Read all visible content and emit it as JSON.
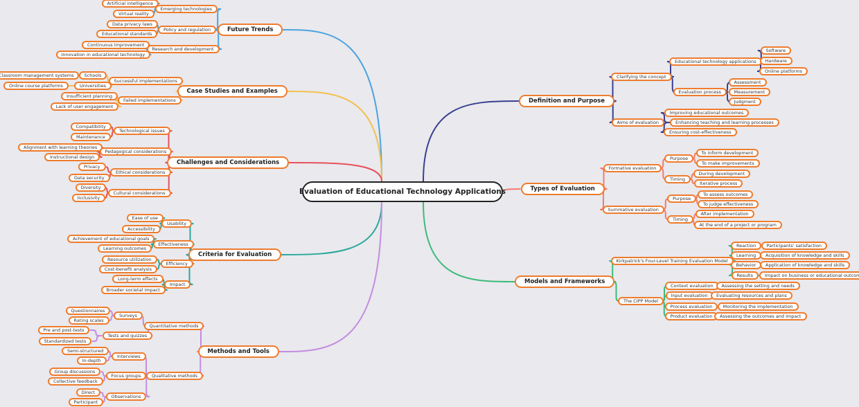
{
  "title": "Evaluation of Educational Technology Applications",
  "colors": {
    "background": "#e9e9ee",
    "node_border": "#ef7b2b",
    "root_border": "#222222"
  },
  "branches": [
    {
      "label": "Future Trends",
      "color": "#4aa3df",
      "side": "left",
      "children": [
        {
          "label": "Emerging technologies",
          "children": [
            {
              "label": "Artificial intelligence"
            },
            {
              "label": "Virtual reality"
            }
          ]
        },
        {
          "label": "Policy and regulation",
          "children": [
            {
              "label": "Data privacy laws"
            },
            {
              "label": "Educational standards"
            }
          ]
        },
        {
          "label": "Research and development",
          "children": [
            {
              "label": "Continuous improvement"
            },
            {
              "label": "Innovation in educational technology"
            }
          ]
        }
      ]
    },
    {
      "label": "Case Studies and Examples",
      "color": "#f2c14e",
      "side": "left",
      "children": [
        {
          "label": "Successful implementations",
          "children": [
            {
              "label": "Schools",
              "children": [
                {
                  "label": "Classroom management systems"
                }
              ]
            },
            {
              "label": "Universities",
              "children": [
                {
                  "label": "Online course platforms"
                }
              ]
            }
          ]
        },
        {
          "label": "Failed implementations",
          "children": [
            {
              "label": "Insufficient planning"
            },
            {
              "label": "Lack of user engagement"
            }
          ]
        }
      ]
    },
    {
      "label": "Challenges and Considerations",
      "color": "#e8505b",
      "side": "left",
      "children": [
        {
          "label": "Technological issues",
          "children": [
            {
              "label": "Compatibility"
            },
            {
              "label": "Maintenance"
            }
          ]
        },
        {
          "label": "Pedagogical considerations",
          "children": [
            {
              "label": "Alignment with learning theories"
            },
            {
              "label": "Instructional design"
            }
          ]
        },
        {
          "label": "Ethical considerations",
          "children": [
            {
              "label": "Privacy"
            },
            {
              "label": "Data security"
            }
          ]
        },
        {
          "label": "Cultural considerations",
          "children": [
            {
              "label": "Diversity"
            },
            {
              "label": "Inclusivity"
            }
          ]
        }
      ]
    },
    {
      "label": "Criteria for Evaluation",
      "color": "#2aa89a",
      "side": "left",
      "children": [
        {
          "label": "Usability",
          "children": [
            {
              "label": "Ease of use"
            },
            {
              "label": "Accessibility"
            }
          ]
        },
        {
          "label": "Effectiveness",
          "children": [
            {
              "label": "Achievement of educational goals"
            },
            {
              "label": "Learning outcomes"
            }
          ]
        },
        {
          "label": "Efficiency",
          "children": [
            {
              "label": "Resource utilization"
            },
            {
              "label": "Cost-benefit analysis"
            }
          ]
        },
        {
          "label": "Impact",
          "children": [
            {
              "label": "Long-term effects"
            },
            {
              "label": "Broader societal impact"
            }
          ]
        }
      ]
    },
    {
      "label": "Methods and Tools",
      "color": "#c58be0",
      "side": "left",
      "children": [
        {
          "label": "Quantitative methods",
          "children": [
            {
              "label": "Surveys",
              "children": [
                {
                  "label": "Questionnaires"
                },
                {
                  "label": "Rating scales"
                }
              ]
            },
            {
              "label": "Tests and quizzes",
              "children": [
                {
                  "label": "Pre and post-tests"
                },
                {
                  "label": "Standardized tests"
                }
              ]
            }
          ]
        },
        {
          "label": "Qualitative methods",
          "children": [
            {
              "label": "Interviews",
              "children": [
                {
                  "label": "Semi-structured"
                },
                {
                  "label": "In-depth"
                }
              ]
            },
            {
              "label": "Focus groups",
              "children": [
                {
                  "label": "Group discussions"
                },
                {
                  "label": "Collective feedback"
                }
              ]
            },
            {
              "label": "Observations",
              "children": [
                {
                  "label": "Direct"
                },
                {
                  "label": "Participant"
                }
              ]
            }
          ]
        }
      ]
    },
    {
      "label": "Definition and Purpose",
      "color": "#3a3f8f",
      "side": "right",
      "children": [
        {
          "label": "Clarifying the concept",
          "children": [
            {
              "label": "Educational technology applications",
              "children": [
                {
                  "label": "Software"
                },
                {
                  "label": "Hardware"
                },
                {
                  "label": "Online platforms"
                }
              ]
            },
            {
              "label": "Evaluation process",
              "children": [
                {
                  "label": "Assessment"
                },
                {
                  "label": "Measurement"
                },
                {
                  "label": "Judgment"
                }
              ]
            }
          ]
        },
        {
          "label": "Aims of evaluation",
          "children": [
            {
              "label": "Improving educational outcomes"
            },
            {
              "label": "Enhancing teaching and learning processes"
            },
            {
              "label": "Ensuring cost-effectiveness"
            }
          ]
        }
      ]
    },
    {
      "label": "Types of Evaluation",
      "color": "#f47a6e",
      "side": "right",
      "children": [
        {
          "label": "Formative evaluation",
          "children": [
            {
              "label": "Purpose",
              "children": [
                {
                  "label": "To inform development"
                },
                {
                  "label": "To make improvements"
                }
              ]
            },
            {
              "label": "Timing",
              "children": [
                {
                  "label": "During development"
                },
                {
                  "label": "Iterative process"
                }
              ]
            }
          ]
        },
        {
          "label": "Summative evaluation",
          "children": [
            {
              "label": "Purpose",
              "children": [
                {
                  "label": "To assess outcomes"
                },
                {
                  "label": "To judge effectiveness"
                }
              ]
            },
            {
              "label": "Timing",
              "children": [
                {
                  "label": "After implementation"
                },
                {
                  "label": "At the end of a project or program"
                }
              ]
            }
          ]
        }
      ]
    },
    {
      "label": "Models and Frameworks",
      "color": "#3dbb78",
      "side": "right",
      "children": [
        {
          "label": "Kirkpatrick's Four-Level Training Evaluation Model",
          "children": [
            {
              "label": "Reaction",
              "children": [
                {
                  "label": "Participants' satisfaction"
                }
              ]
            },
            {
              "label": "Learning",
              "children": [
                {
                  "label": "Acquisition of knowledge and skills"
                }
              ]
            },
            {
              "label": "Behavior",
              "children": [
                {
                  "label": "Application of knowledge and skills"
                }
              ]
            },
            {
              "label": "Results",
              "children": [
                {
                  "label": "Impact on business or educational outcomes"
                }
              ]
            }
          ]
        },
        {
          "label": "The CIPP Model",
          "children": [
            {
              "label": "Context evaluation",
              "children": [
                {
                  "label": "Assessing the setting and needs"
                }
              ]
            },
            {
              "label": "Input evaluation",
              "children": [
                {
                  "label": "Evaluating resources and plans"
                }
              ]
            },
            {
              "label": "Process evaluation",
              "children": [
                {
                  "label": "Monitoring the implementation"
                }
              ]
            },
            {
              "label": "Product evaluation",
              "children": [
                {
                  "label": "Assessing the outcomes and impact"
                }
              ]
            }
          ]
        }
      ]
    }
  ]
}
